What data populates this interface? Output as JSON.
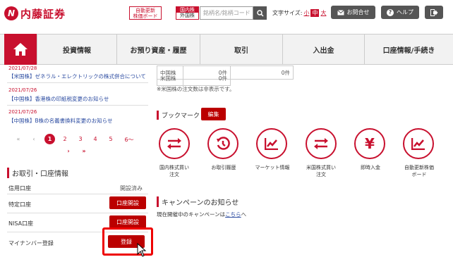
{
  "header": {
    "logo_text": "内藤証券",
    "realtime_btn_line1": "自動更新",
    "realtime_btn_line2": "株価ボード",
    "market_line1": "国内株",
    "market_line2": "外国株",
    "search_placeholder": "銘柄名/銘柄コード",
    "font_size_label": "文字サイズ:",
    "font_small": "小",
    "font_mid": "中",
    "font_large": "大",
    "contact_label": "お問合せ",
    "help_label": "ヘルプ"
  },
  "nav": {
    "items": [
      "投資情報",
      "お預り資産・履歴",
      "取引",
      "入出金",
      "口座情報/手続き"
    ]
  },
  "news": [
    {
      "date": "2021/07/28",
      "title": "【米国株】ゼネラル・エレクトリックの株式併合について"
    },
    {
      "date": "2021/07/26",
      "title": "【中国株】香港株の印紙税変更のお知らせ"
    },
    {
      "date": "2021/07/26",
      "title": "【中国株】B株の名義書換料変更のお知らせ"
    }
  ],
  "pagination": {
    "first": "«",
    "prev": "‹",
    "pages": [
      "1",
      "2",
      "3",
      "4",
      "5",
      "6～"
    ],
    "next": "›",
    "last": "»"
  },
  "account_section": {
    "title": "お取引・口座情報",
    "rows": [
      {
        "label": "信用口座",
        "status": "開設済み"
      },
      {
        "label": "特定口座",
        "button": "口座開設"
      },
      {
        "label": "NISA口座",
        "button": "口座開設"
      },
      {
        "label": "マイナンバー登録",
        "button": "登録"
      }
    ]
  },
  "orders_table": {
    "rows": [
      {
        "market": "中国株",
        "col2": "0件",
        "col3": "0件"
      },
      {
        "market": "米国株",
        "col2": "0件",
        "col3": ""
      }
    ],
    "note": "※米国株の注文数は非表示です。"
  },
  "bookmark": {
    "title": "ブックマーク",
    "edit_label": "編集",
    "items": [
      {
        "icon": "swap-arrows-icon",
        "label_line1": "国内株式買い",
        "label_line2": "注文"
      },
      {
        "icon": "history-icon",
        "label_line1": "お取引履歴",
        "label_line2": ""
      },
      {
        "icon": "chart-icon",
        "label_line1": "マーケット情報",
        "label_line2": ""
      },
      {
        "icon": "swap-arrows-icon",
        "label_line1": "米国株式買い",
        "label_line2": "注文"
      },
      {
        "icon": "yen-icon",
        "label_line1": "即時入金",
        "label_line2": ""
      },
      {
        "icon": "chart-icon",
        "label_line1": "自動更新株価",
        "label_line2": "ボード"
      }
    ]
  },
  "campaign": {
    "title": "キャンペーンのお知らせ",
    "text_before": "現在開催中のキャンペーンは",
    "link_text": "こちら",
    "text_after": "へ"
  },
  "colors": {
    "brand_red": "#c8102e",
    "link_blue": "#2a4aa0"
  }
}
